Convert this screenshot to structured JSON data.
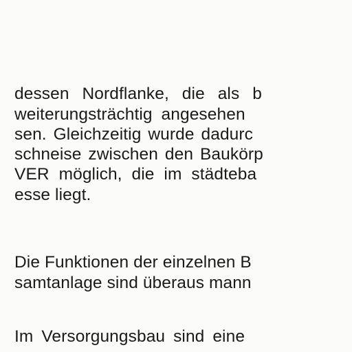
{
  "document": {
    "paragraphs": [
      {
        "lines": [
          "dessen Nordflanke, die als b",
          "weiterungsträchtig angesehen",
          "sen. Gleichzeitig wurde dadurc",
          "schneise zwischen den Baukörp",
          "VER möglich, die im städteba",
          "esse liegt."
        ]
      },
      {
        "lines": [
          "Die Funktionen der einzelnen B",
          "samtanlage sind überaus mann"
        ]
      },
      {
        "lines": [
          "Im Versorgungsbau sind eine"
        ]
      }
    ]
  }
}
